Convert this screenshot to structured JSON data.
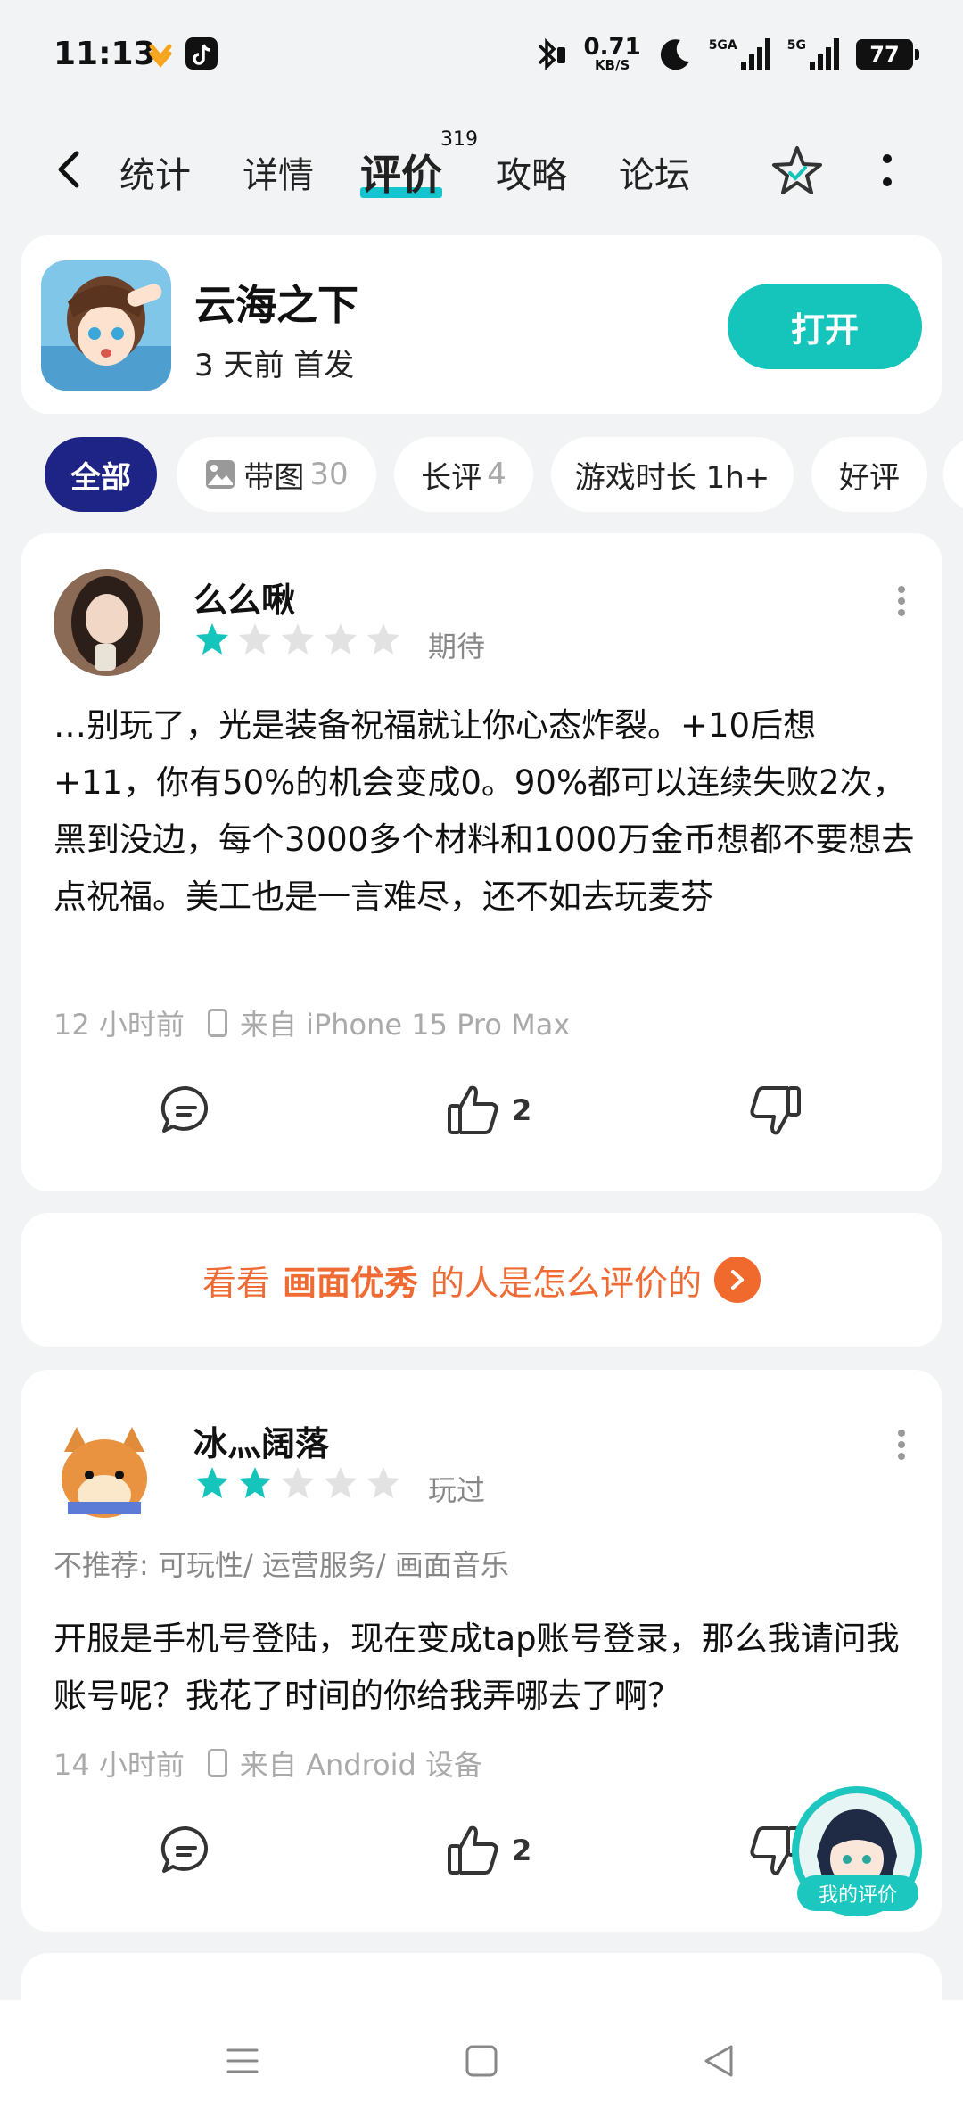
{
  "status_bar": {
    "time": "11:13",
    "net_speed_value": "0.71",
    "net_speed_unit": "KB/S",
    "sim1_label": "5GA",
    "sim2_label": "5G",
    "battery": "77"
  },
  "nav": {
    "tabs": [
      "统计",
      "详情",
      "评价",
      "攻略",
      "论坛"
    ],
    "active_tab": "评价",
    "review_count": "319"
  },
  "game": {
    "name": "云海之下",
    "subtitle": "3 天前 首发",
    "open_label": "打开"
  },
  "filters": [
    {
      "label": "全部",
      "count": ""
    },
    {
      "label": "带图",
      "count": "30"
    },
    {
      "label": "长评",
      "count": "4"
    },
    {
      "label": "游戏时长 1h+",
      "count": ""
    },
    {
      "label": "好评",
      "count": ""
    }
  ],
  "reviews": [
    {
      "username": "么么啾",
      "rating": 1,
      "status": "期待",
      "tags": "",
      "content": "…别玩了，光是装备祝福就让你心态炸裂。+10后想+11，你有50%的机会变成0。90%都可以连续失败2次，黑到没边，每个3000多个材料和1000万金币想都不要想去点祝福。美工也是一言难尽，还不如去玩麦芬",
      "time": "12 小时前",
      "device": "来自 iPhone 15 Pro Max",
      "likes": "2"
    },
    {
      "username": "冰灬阔落",
      "rating": 2,
      "status": "玩过",
      "tags": "不推荐: 可玩性/ 运营服务/ 画面音乐",
      "content": "开服是手机号登陆，现在变成tap账号登录，那么我请问我账号呢？我花了时间的你给我弄哪去了啊？",
      "time": "14 小时前",
      "device": "来自 Android 设备",
      "likes": "2"
    }
  ],
  "promo": {
    "prefix": "看看",
    "highlight": "画面优秀",
    "suffix": "的人是怎么评价的"
  },
  "floating": {
    "label": "我的评价"
  },
  "colors": {
    "accent": "#15c5bc",
    "chip_active": "#1d2485",
    "promo": "#ef6b33",
    "star_on": "#15c5bc",
    "star_off": "#e2e2e2"
  }
}
